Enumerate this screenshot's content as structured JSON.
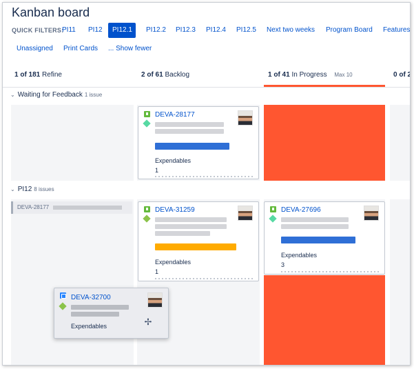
{
  "title": "Kanban board",
  "quick_filters": {
    "label": "QUICK FILTERS:",
    "items": [
      "PI11",
      "PI12",
      "PI12.1",
      "PI12.2",
      "PI12.3",
      "PI12.4",
      "PI12.5",
      "Next two weeks",
      "Program Board",
      "Features"
    ],
    "active": "PI12.1",
    "row2": [
      "Unassigned",
      "Print Cards",
      "... Show fewer"
    ]
  },
  "columns": [
    {
      "count": "1 of 181",
      "name": "Refine"
    },
    {
      "count": "2 of 61",
      "name": "Backlog"
    },
    {
      "count": "1 of 41",
      "name": "In Progress",
      "max": "Max 10"
    },
    {
      "count": "0 of 2",
      "name": ""
    }
  ],
  "swimlanes": [
    {
      "name": "Waiting for Feedback",
      "count": "1 issue"
    },
    {
      "name": "PI12",
      "count": "8 issues"
    }
  ],
  "cards": {
    "deva_28177": {
      "key": "DEVA-28177",
      "field_name": "Expendables",
      "field_value": "1"
    },
    "deva_31259": {
      "key": "DEVA-31259",
      "field_name": "Expendables",
      "field_value": "1"
    },
    "deva_27696": {
      "key": "DEVA-27696",
      "field_name": "Expendables",
      "field_value": "3"
    },
    "mini": {
      "key": "DEVA-28177"
    },
    "dragging": {
      "key": "DEVA-32700",
      "field_name": "Expendables"
    }
  },
  "colors": {
    "accent": "#0052cc",
    "in_progress": "#ff5630",
    "story": "#63ba3c",
    "task": "#2684ff"
  },
  "icons": [
    "story-icon",
    "priority-icon",
    "task-icon",
    "avatar",
    "move-cursor-icon",
    "chevron-down-icon"
  ]
}
